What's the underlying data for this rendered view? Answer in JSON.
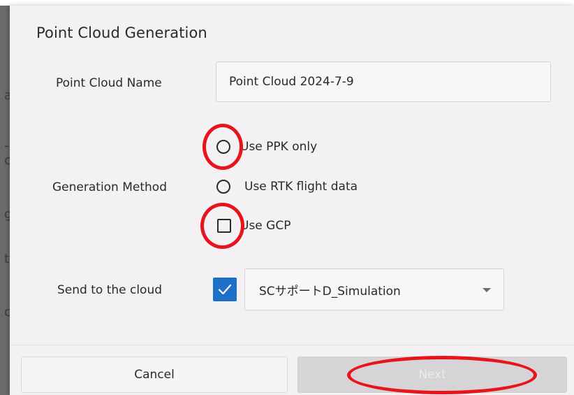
{
  "background": {
    "fragments": [
      "ac",
      "-c",
      "g",
      "ta",
      "c"
    ]
  },
  "dialog": {
    "title": "Point Cloud Generation",
    "point_cloud_name": {
      "label": "Point Cloud Name",
      "value": "Point Cloud 2024-7-9"
    },
    "generation_method": {
      "label": "Generation Method",
      "options": [
        {
          "label": "Use PPK only",
          "type": "radio",
          "selected": false,
          "highlighted": true
        },
        {
          "label": "Use RTK flight data",
          "type": "radio",
          "selected": false,
          "highlighted": false
        },
        {
          "label": "Use GCP",
          "type": "checkbox",
          "checked": false,
          "highlighted": true
        }
      ]
    },
    "send_to_cloud": {
      "label": "Send to the cloud",
      "checked": true,
      "selected_project": "SCサポートD_Simulation"
    },
    "buttons": {
      "cancel": "Cancel",
      "next": "Next"
    }
  },
  "colors": {
    "accent": "#1e6fc8",
    "annotation": "#e8141c",
    "dialog_bg": "#f3f1f3",
    "disabled_button": "#d6d4d6"
  },
  "icons": {
    "dropdown": "chevron-down-icon",
    "check": "check-icon"
  }
}
